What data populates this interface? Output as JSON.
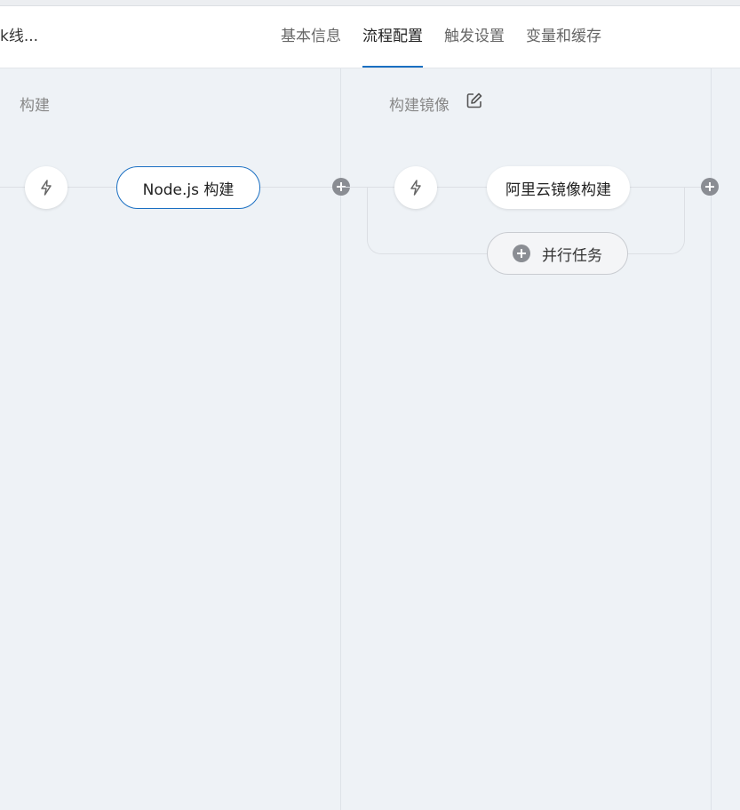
{
  "header": {
    "pipeline_name": "k线...",
    "tabs": [
      {
        "label": "基本信息",
        "active": false
      },
      {
        "label": "流程配置",
        "active": true
      },
      {
        "label": "触发设置",
        "active": false
      },
      {
        "label": "变量和缓存",
        "active": false
      }
    ]
  },
  "stages": [
    {
      "title": "构建",
      "trigger_icon": "lightning-icon",
      "jobs": [
        {
          "label": "Node.js 构建",
          "selected": true
        }
      ]
    },
    {
      "title": "构建镜像",
      "edit_icon": "edit-icon",
      "trigger_icon": "lightning-icon",
      "jobs": [
        {
          "label": "阿里云镜像构建",
          "selected": false
        }
      ],
      "parallel_label": "并行任务"
    }
  ],
  "colors": {
    "accent": "#1a6fc2",
    "canvas_bg": "#eef2f6",
    "plus_dot": "#8a8d93"
  }
}
